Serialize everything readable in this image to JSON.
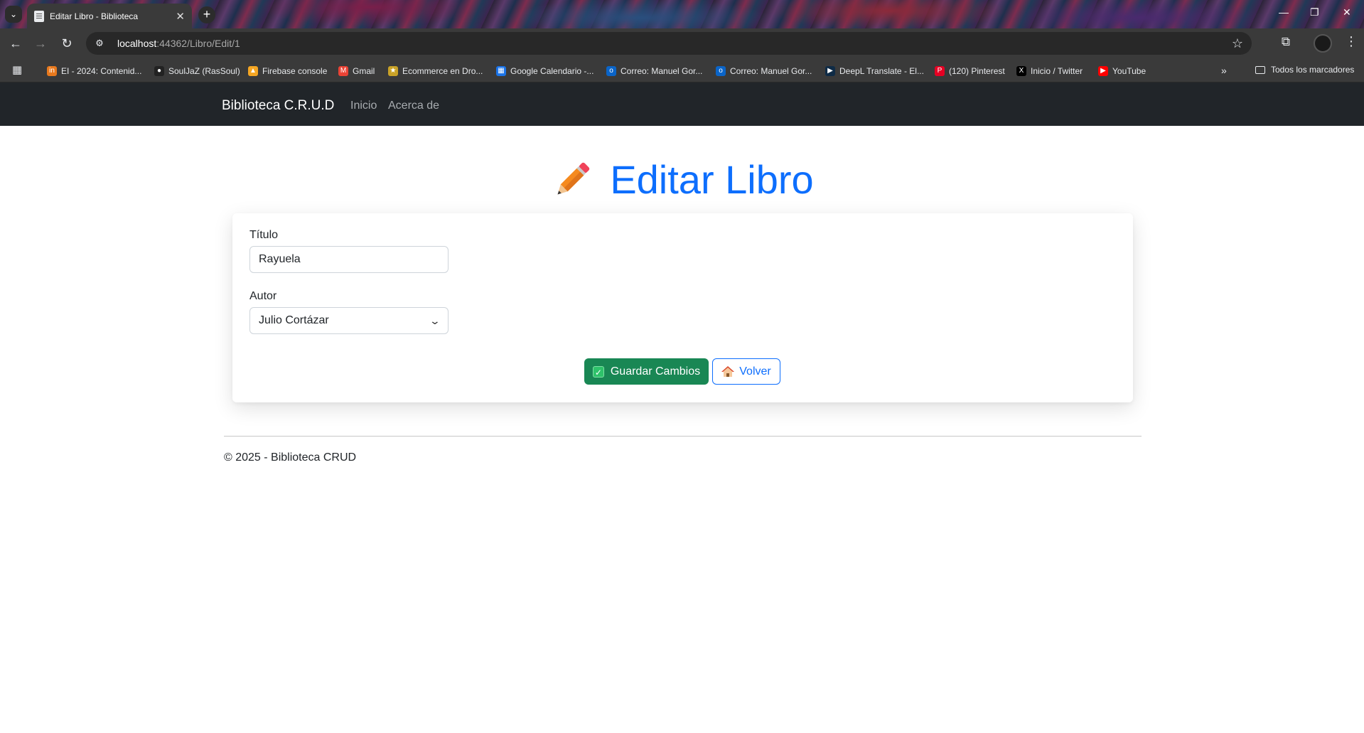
{
  "browser": {
    "tab_title": "Editar Libro - Biblioteca",
    "url_host": "localhost",
    "url_path": ":44362/Libro/Edit/1",
    "bookmarks": [
      {
        "label": "EI - 2024: Contenid...",
        "icon": "in-icon",
        "color": "#e8791d"
      },
      {
        "label": "SoulJaZ (RasSoul)",
        "icon": "github-icon",
        "color": "#222222"
      },
      {
        "label": "Firebase console",
        "icon": "firebase-icon",
        "color": "#f5a623"
      },
      {
        "label": "Gmail",
        "icon": "gmail-icon",
        "color": "#ea4335"
      },
      {
        "label": "Ecommerce en Dro...",
        "icon": "dropshipping-icon",
        "color": "#c9a227"
      },
      {
        "label": "Google Calendario -...",
        "icon": "calendar-icon",
        "color": "#1a73e8"
      },
      {
        "label": "Correo: Manuel Gor...",
        "icon": "outlook-icon",
        "color": "#0a64c8"
      },
      {
        "label": "Correo: Manuel Gor...",
        "icon": "outlook-icon",
        "color": "#0a64c8"
      },
      {
        "label": "DeepL Translate - El...",
        "icon": "deepl-icon",
        "color": "#0f2b46"
      },
      {
        "label": "(120) Pinterest",
        "icon": "pinterest-icon",
        "color": "#e60023"
      },
      {
        "label": "Inicio / Twitter",
        "icon": "x-icon",
        "color": "#000000"
      },
      {
        "label": "YouTube",
        "icon": "youtube-icon",
        "color": "#ff0000"
      }
    ],
    "all_bookmarks_label": "Todos los marcadores"
  },
  "nav": {
    "brand": "Biblioteca C.R.U.D",
    "links": [
      "Inicio",
      "Acerca de"
    ]
  },
  "page": {
    "title": "Editar Libro",
    "title_icon": "pencil-icon"
  },
  "form": {
    "titulo_label": "Título",
    "titulo_value": "Rayuela",
    "autor_label": "Autor",
    "autor_selected": "Julio Cortázar",
    "save_label": "Guardar Cambios",
    "back_label": "Volver"
  },
  "footer": {
    "text": "© 2025 - Biblioteca CRUD"
  },
  "colors": {
    "primary": "#0d6efd",
    "success": "#198754",
    "navbar": "#212529"
  }
}
